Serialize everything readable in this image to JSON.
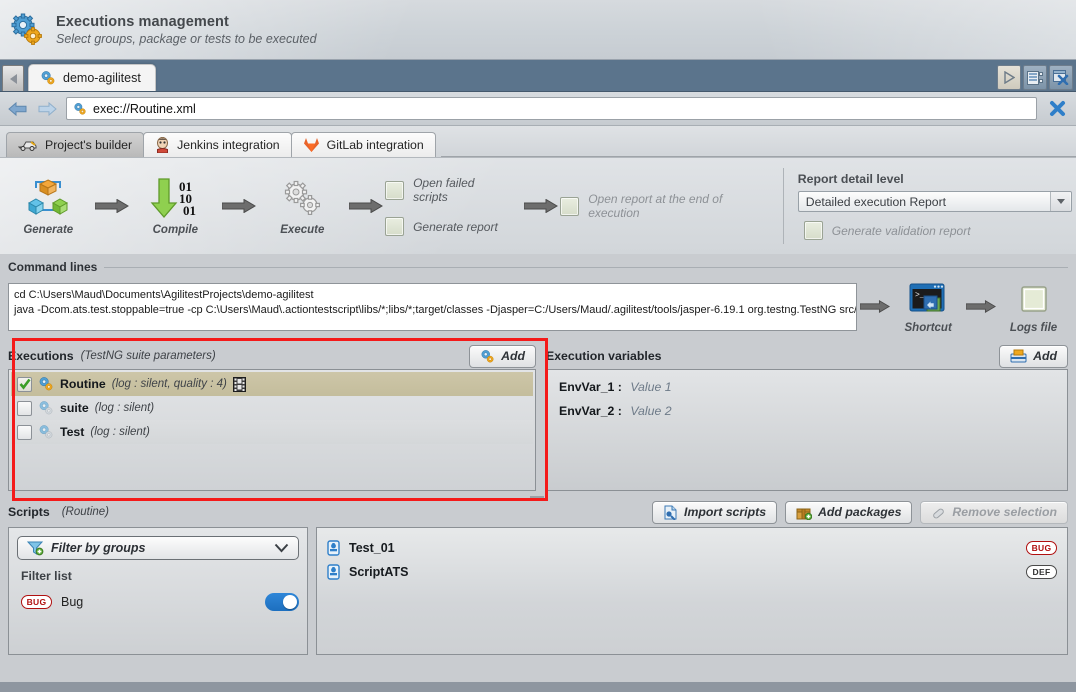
{
  "header": {
    "icon": "gears-icon",
    "title": "Executions management",
    "subtitle": "Select groups, package or tests to be executed"
  },
  "tabstrip": {
    "scroll_left_icon": "triangle-left-icon",
    "tab_label": "demo-agilitest",
    "tab_icon": "gears-icon",
    "right_buttons": [
      {
        "name": "run-button",
        "icon": "play-triangle-icon"
      },
      {
        "name": "list-view-button",
        "icon": "list-lines-icon"
      },
      {
        "name": "close-all-button",
        "icon": "close-window-icon"
      }
    ]
  },
  "addressbar": {
    "back_icon": "arrow-left-icon",
    "forward_icon": "arrow-right-icon",
    "field_icon": "gears-icon",
    "url": "exec://Routine.xml",
    "close_icon": "blue-cross-icon"
  },
  "builder_tabs": [
    {
      "label": "Project's builder",
      "icon": "builder-icon",
      "active": true
    },
    {
      "label": "Jenkins integration",
      "icon": "jenkins-icon",
      "active": false
    },
    {
      "label": "GitLab integration",
      "icon": "gitlab-icon",
      "active": false
    }
  ],
  "workflow": {
    "steps": [
      {
        "label": "Generate",
        "icon": "generate-cubes-icon"
      },
      {
        "label": "Compile",
        "icon": "compile-arrow-binary-icon"
      },
      {
        "label": "Execute",
        "icon": "execute-gears-icon"
      }
    ],
    "checkboxes": [
      {
        "label": "Open failed scripts",
        "checked": false,
        "dim": false
      },
      {
        "label": "Generate report",
        "checked": false,
        "dim": false
      },
      {
        "label": "Open  report at the end of execution",
        "checked": false,
        "dim": true
      }
    ],
    "report": {
      "title": "Report detail level",
      "select_value": "Detailed execution Report",
      "select_options": [
        "Detailed execution Report"
      ],
      "validation_label": "Generate validation report",
      "validation_checked": false
    }
  },
  "command_lines": {
    "legend": "Command lines",
    "line1": "cd C:\\Users\\Maud\\Documents\\AgilitestProjects\\demo-agilitest",
    "line2": "java -Dcom.ats.test.stoppable=true -cp C:\\Users\\Maud\\.actiontestscript\\libs/*;libs/*;target/classes -Djasper=C:/Users/Maud/.agilitest/tools/jasper-6.19.1 org.testng.TestNG src/exec/Rout",
    "tools": [
      {
        "label": "Shortcut",
        "icon": "terminal-shortcut-icon"
      },
      {
        "label": "Logs file",
        "icon": "logs-file-icon"
      }
    ]
  },
  "executions": {
    "title": "Executions",
    "subtitle": "(TestNG suite parameters)",
    "add_label": "Add",
    "add_icon": "gears-icon",
    "rows": [
      {
        "name": "Routine",
        "meta": "(log : silent, quality : 4)",
        "checked": true,
        "selected": true,
        "icon": "gears-icon",
        "extra_icon": "film-strip-icon"
      },
      {
        "name": "suite",
        "meta": "(log : silent)",
        "checked": false,
        "selected": false,
        "icon": "gears-icon",
        "extra_icon": ""
      },
      {
        "name": "Test",
        "meta": "(log : silent)",
        "checked": false,
        "selected": false,
        "icon": "gears-icon",
        "extra_icon": ""
      }
    ]
  },
  "execution_variables": {
    "title": "Execution variables",
    "add_label": "Add",
    "add_icon": "drawer-icon",
    "rows": [
      {
        "key": "EnvVar_1 :",
        "value": "Value 1"
      },
      {
        "key": "EnvVar_2 :",
        "value": "Value 2"
      }
    ]
  },
  "scripts": {
    "title": "Scripts",
    "subtitle": "(Routine)",
    "buttons": [
      {
        "label": "Import scripts",
        "icon": "import-scripts-icon",
        "disabled": false
      },
      {
        "label": "Add packages",
        "icon": "add-package-icon",
        "disabled": false
      },
      {
        "label": "Remove selection",
        "icon": "eraser-icon",
        "disabled": true
      }
    ],
    "filter": {
      "select_label": "Filter by groups",
      "select_icon": "funnel-add-icon",
      "chevron_icon": "chevron-down-icon",
      "list_title": "Filter list",
      "items": [
        {
          "badge": "BUG",
          "badge_type": "bug",
          "label": "Bug",
          "toggle_on": true
        }
      ]
    },
    "items": [
      {
        "name": "Test_01",
        "icon": "script-icon",
        "badge": "BUG",
        "badge_type": "bug"
      },
      {
        "name": "ScriptATS",
        "icon": "script-icon",
        "badge": "DEF",
        "badge_type": "def"
      }
    ]
  },
  "colors": {
    "accent_blue": "#2e86d8",
    "highlight_red": "#f41a1a",
    "tabstrip_blue": "#5b748c",
    "selected_row": "#c9c2a3",
    "bug_badge": "#b01010"
  }
}
